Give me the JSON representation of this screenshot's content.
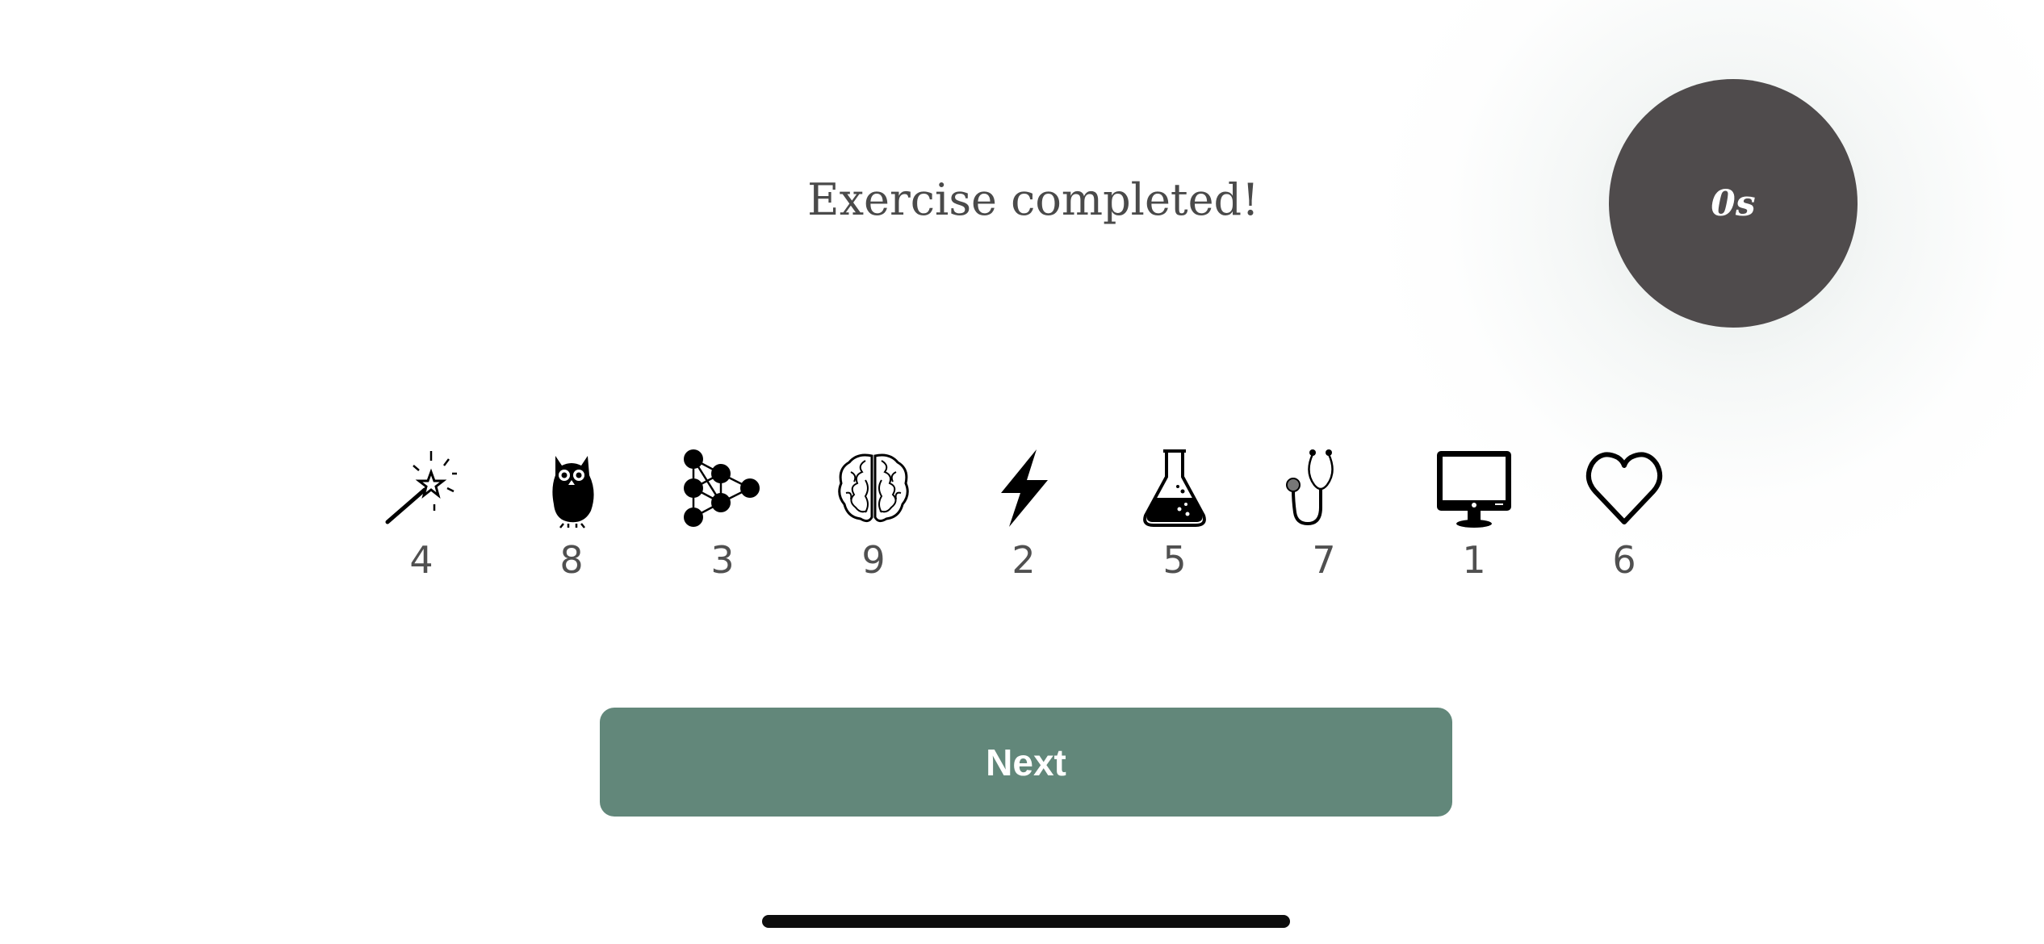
{
  "title": "Exercise completed!",
  "timer": {
    "label": "0s"
  },
  "symbols": [
    {
      "icon": "magic-wand-icon",
      "number": "4"
    },
    {
      "icon": "owl-icon",
      "number": "8"
    },
    {
      "icon": "network-graph-icon",
      "number": "3"
    },
    {
      "icon": "brain-icon",
      "number": "9"
    },
    {
      "icon": "lightning-bolt-icon",
      "number": "2"
    },
    {
      "icon": "flask-icon",
      "number": "5"
    },
    {
      "icon": "stethoscope-icon",
      "number": "7"
    },
    {
      "icon": "monitor-icon",
      "number": "1"
    },
    {
      "icon": "heart-icon",
      "number": "6"
    }
  ],
  "next_button": {
    "label": "Next"
  },
  "colors": {
    "accent": "#62877a",
    "timer_bg": "#4f4b4c",
    "text": "#4a4a4a"
  }
}
